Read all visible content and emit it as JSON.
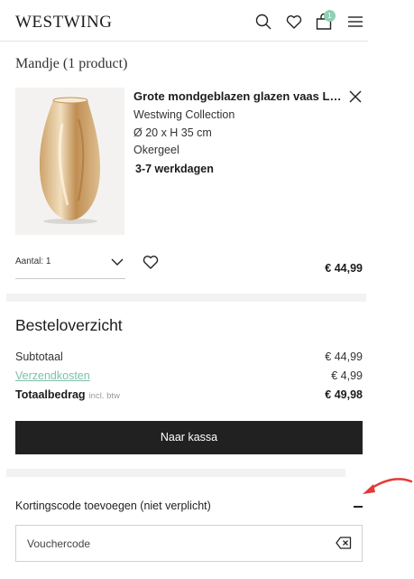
{
  "header": {
    "logo": "WESTWING",
    "cart_count": "1"
  },
  "basket": {
    "title": "Mandje (1 product)"
  },
  "product": {
    "name": "Grote mondgeblazen glazen vaas Lustre",
    "brand": "Westwing Collection",
    "dimensions": "Ø 20 x H 35 cm",
    "color": "Okergeel",
    "delivery": "3-7 werkdagen",
    "quantity_label": "Aantal: 1",
    "price": "€ 44,99"
  },
  "summary": {
    "title": "Besteloverzicht",
    "subtotal_label": "Subtotaal",
    "subtotal_value": "€ 44,99",
    "shipping_label": "Verzendkosten",
    "shipping_value": "€ 4,99",
    "total_label": "Totaalbedrag",
    "total_note": "incl. btw",
    "total_value": "€ 49,98",
    "checkout_label": "Naar kassa"
  },
  "discount": {
    "title": "Kortingscode toevoegen (niet verplicht)",
    "voucher_placeholder": "Vouchercode"
  },
  "colors": {
    "accent": "#8fcfb4",
    "link": "#7cc2a7",
    "button": "#212121",
    "annotation": "#e53935"
  }
}
